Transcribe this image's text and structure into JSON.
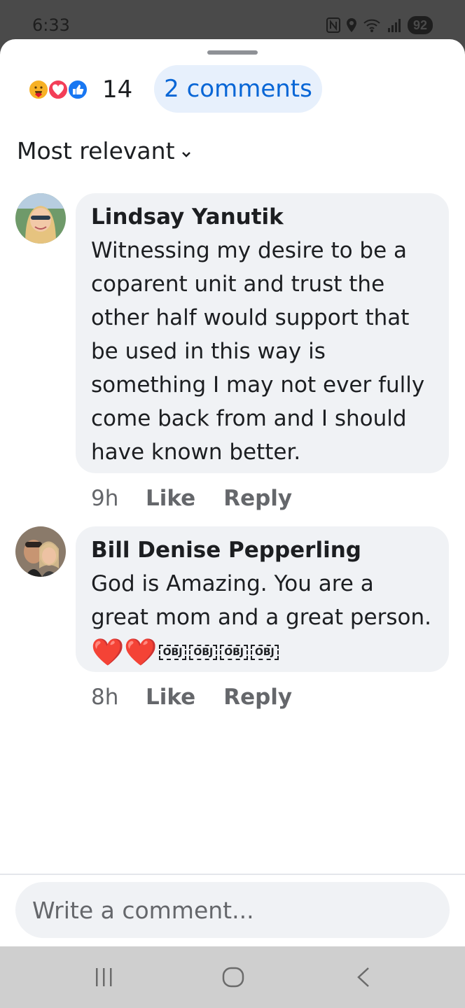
{
  "status_bar": {
    "time": "6:33",
    "battery": "92",
    "icons": [
      "nfc-icon",
      "location-icon",
      "wifi-icon",
      "signal-icon",
      "battery-icon"
    ]
  },
  "reactions": {
    "icons": [
      "care-reaction-icon",
      "love-reaction-icon",
      "like-reaction-icon"
    ],
    "count": "14"
  },
  "comments_button": {
    "label": "2 comments"
  },
  "sort": {
    "label": "Most relevant"
  },
  "comments": [
    {
      "author": "Lindsay Yanutik",
      "text": "Witnessing my desire to be a coparent unit and trust the other half would support that be used in this way is something I may not ever fully come back from and I should have known better.",
      "time": "9h",
      "like_label": "Like",
      "reply_label": "Reply"
    },
    {
      "author": "Bill Denise Pepperling",
      "text": "God is Amazing. You are a great mom and a great person.",
      "emoji": "❤️❤️",
      "obj_labels": [
        "OBJ",
        "OBJ",
        "OBJ",
        "OBJ"
      ],
      "time": "8h",
      "like_label": "Like",
      "reply_label": "Reply"
    }
  ],
  "composer": {
    "placeholder": "Write a comment..."
  },
  "nav_bar": {
    "icons": [
      "recent-apps-icon",
      "home-icon",
      "back-icon"
    ]
  },
  "colors": {
    "accent": "#0866d6",
    "pill_bg": "#e7f0fc",
    "bubble_bg": "#f0f2f5",
    "heart": "#e0142a"
  }
}
